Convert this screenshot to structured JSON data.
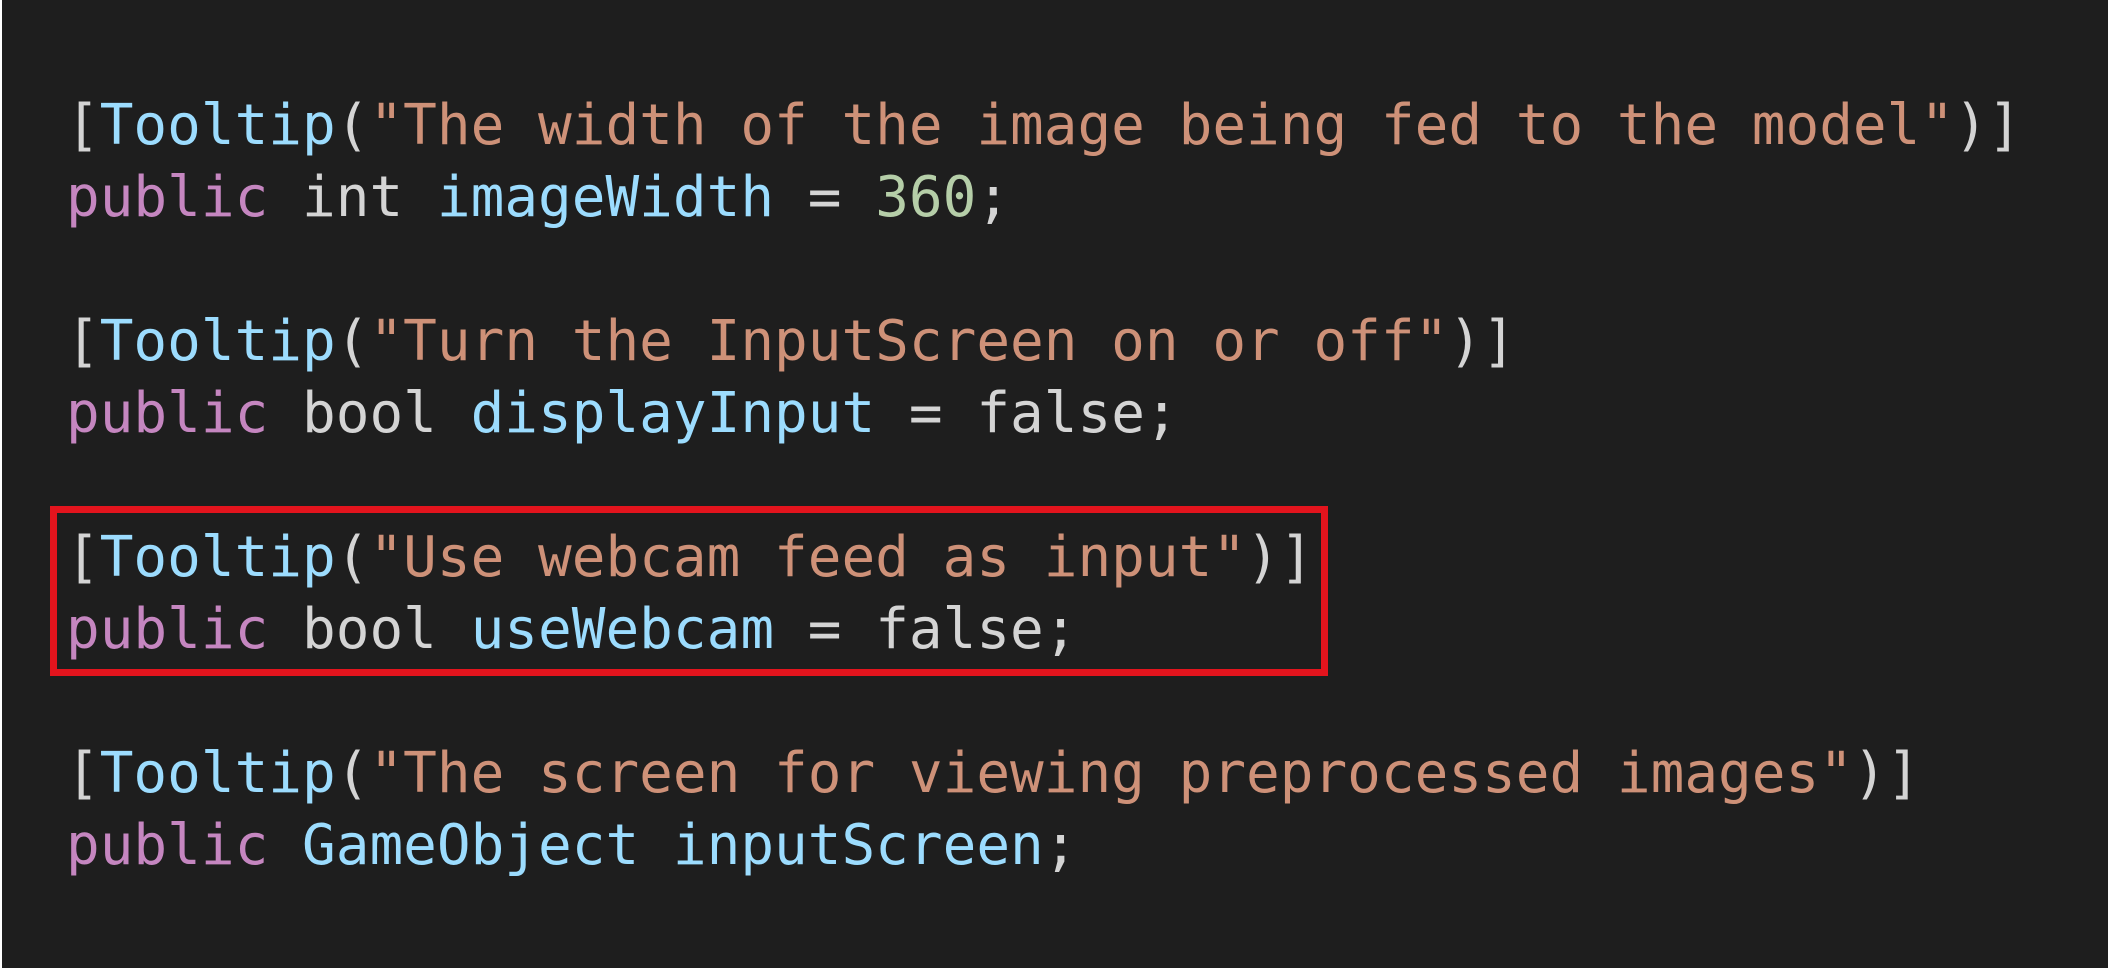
{
  "code": {
    "block1": {
      "attr_open": "[",
      "attr_name": "Tooltip",
      "paren_open": "(",
      "string": "\"The width of the image being fed to the model\"",
      "attr_close": ")]",
      "kw": "public",
      "type": "int",
      "ident": "imageWidth",
      "op": "=",
      "value": "360",
      "end": ";"
    },
    "block2": {
      "attr_open": "[",
      "attr_name": "Tooltip",
      "paren_open": "(",
      "string": "\"Turn the InputScreen on or off\"",
      "attr_close": ")]",
      "kw": "public",
      "type": "bool",
      "ident": "displayInput",
      "op": "=",
      "value": "false",
      "end": ";"
    },
    "block3": {
      "attr_open": "[",
      "attr_name": "Tooltip",
      "paren_open": "(",
      "string": "\"Use webcam feed as input\"",
      "attr_close": ")]",
      "kw": "public",
      "type": "bool",
      "ident": "useWebcam",
      "op": "=",
      "value": "false",
      "end": ";"
    },
    "block4": {
      "attr_open": "[",
      "attr_name": "Tooltip",
      "paren_open": "(",
      "string": "\"The screen for viewing preprocessed images\"",
      "attr_close": ")]",
      "kw": "public",
      "type": "GameObject",
      "ident": "inputScreen",
      "end": ";"
    }
  },
  "colors": {
    "background": "#1e1e1e",
    "keyword": "#c586c0",
    "identifier": "#9cdcfe",
    "string": "#ce9178",
    "number": "#b5cea8",
    "plain": "#d4d4d4",
    "highlight_border": "#e3141d"
  }
}
